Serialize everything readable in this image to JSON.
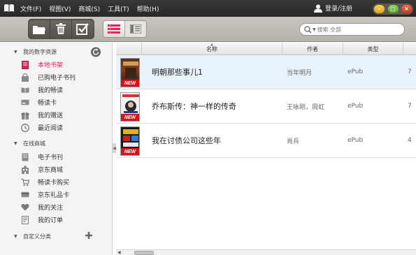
{
  "menu": {
    "items": [
      {
        "label": "文件(F)"
      },
      {
        "label": "视图(V)"
      },
      {
        "label": "商城(S)"
      },
      {
        "label": "工具(T)"
      },
      {
        "label": "帮助(H)"
      }
    ]
  },
  "header": {
    "login_label": "登录/注册"
  },
  "toolbar": {
    "buttons": [
      "folder-icon",
      "trash-icon",
      "checkbox-icon"
    ],
    "view_modes": [
      "list-view-icon",
      "detail-view-icon"
    ],
    "active_view": "list"
  },
  "search": {
    "placeholder": "搜索 全部"
  },
  "sidebar": {
    "sections": [
      {
        "title": "我的数字资源",
        "items": [
          {
            "label": "本地书架",
            "icon": "bookshelf-icon",
            "active": true
          },
          {
            "label": "已购电子书刊",
            "icon": "bag-icon"
          },
          {
            "label": "我的畅读",
            "icon": "open-book-icon"
          },
          {
            "label": "畅读卡",
            "icon": "card-icon"
          },
          {
            "label": "我的赠送",
            "icon": "gift-icon"
          },
          {
            "label": "最近阅读",
            "icon": "clock-icon"
          }
        ]
      },
      {
        "title": "在线商城",
        "items": [
          {
            "label": "电子书刊",
            "icon": "ebook-icon"
          },
          {
            "label": "京东商城",
            "icon": "building-icon"
          },
          {
            "label": "畅读卡购买",
            "icon": "cart-icon"
          },
          {
            "label": "京东礼品卡",
            "icon": "gift-card-icon"
          },
          {
            "label": "我的关注",
            "icon": "heart-icon"
          },
          {
            "label": "我的订单",
            "icon": "order-icon"
          }
        ]
      },
      {
        "title": "自定义分类",
        "items": []
      }
    ]
  },
  "table": {
    "columns": [
      "名称",
      "作者",
      "类型"
    ],
    "rows": [
      {
        "name": "明朝那些事儿1",
        "author": "当年明月",
        "type": "ePub",
        "extra": "7",
        "badge": "NEW",
        "selected": true
      },
      {
        "name": "乔布斯传：神一样的传奇",
        "author": "王咏刚，周虹",
        "type": "ePub",
        "extra": "7",
        "badge": "NEW",
        "selected": false
      },
      {
        "name": "我在讨债公司这些年",
        "author": "肖兵",
        "type": "ePub",
        "extra": "4",
        "badge": "NEW",
        "selected": false
      }
    ]
  },
  "colors": {
    "accent": "#e22459",
    "titlebar": "#2f2d2c",
    "selected_row": "#e9f3fb",
    "badge": "#d4141a"
  }
}
